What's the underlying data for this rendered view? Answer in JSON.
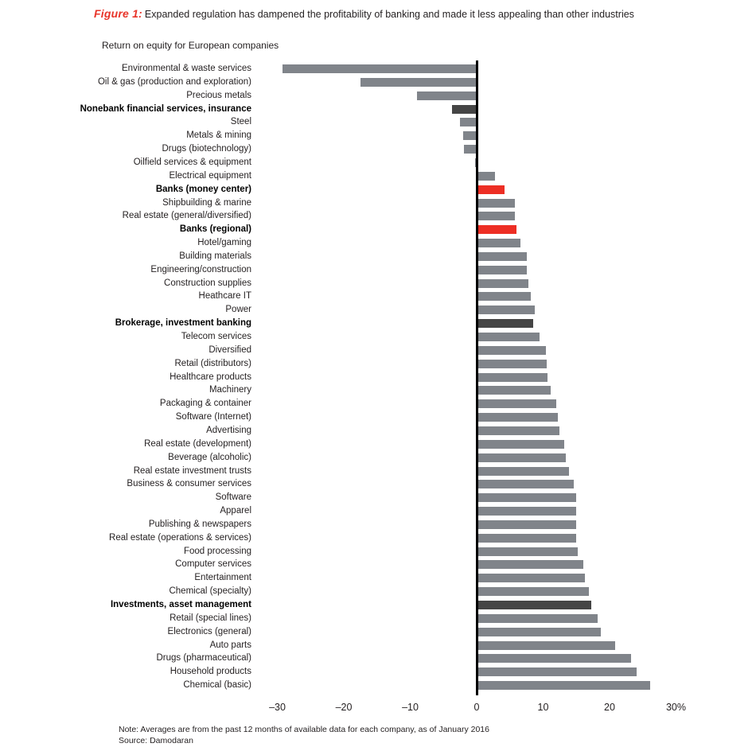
{
  "figure": {
    "label": "Figure 1:",
    "caption": "Expanded regulation has dampened the profitability of banking and made it less appealing than other industries",
    "subtitle": "Return on equity for European companies",
    "note": "Note: Averages are from the past 12 months of available data for each company, as of January 2016",
    "source": "Source: Damodaran"
  },
  "colors": {
    "gray": "#80848a",
    "dark": "#454545",
    "red": "#ed2e24",
    "accent": "#ed2e24",
    "axis": "#000000"
  },
  "chart_data": {
    "type": "bar",
    "orientation": "horizontal",
    "title": "Expanded regulation has dampened the profitability of banking and made it less appealing than other industries",
    "subtitle": "Return on equity for European companies",
    "xlabel": "",
    "ylabel": "",
    "xlim": [
      -33,
      30
    ],
    "xticks": [
      -30,
      -20,
      -10,
      0,
      10,
      20,
      30
    ],
    "xticklabels": [
      "–30",
      "–20",
      "–10",
      "0",
      "10",
      "20",
      "30%"
    ],
    "grid": false,
    "legend": false,
    "note": "Note: Averages are from the past 12 months of available data for each company, as of January 2016",
    "source": "Source: Damodaran",
    "categories": [
      "Environmental & waste services",
      "Oil & gas (production and exploration)",
      "Precious metals",
      "Nonebank financial services, insurance",
      "Steel",
      "Metals & mining",
      "Drugs (biotechnology)",
      "Oilfield services & equipment",
      "Electrical equipment",
      "Banks (money center)",
      "Shipbuilding & marine",
      "Real estate (general/diversified)",
      "Banks (regional)",
      "Hotel/gaming",
      "Building materials",
      "Engineering/construction",
      "Construction supplies",
      "Heathcare IT",
      "Power",
      "Brokerage, investment banking",
      "Telecom services",
      "Diversified",
      "Retail (distributors)",
      "Healthcare products",
      "Machinery",
      "Packaging & container",
      "Software (Internet)",
      "Advertising",
      "Real estate (development)",
      "Beverage (alcoholic)",
      "Real estate investment trusts",
      "Business & consumer services",
      "Software",
      "Apparel",
      "Publishing & newspapers",
      "Real estate (operations & services)",
      "Food processing",
      "Computer services",
      "Entertainment",
      "Chemical (specialty)",
      "Investments, asset management",
      "Retail (special lines)",
      "Electronics (general)",
      "Auto parts",
      "Drugs (pharmaceutical)",
      "Household products",
      "Chemical (basic)"
    ],
    "values": [
      -29.2,
      -17.5,
      -9.0,
      -3.7,
      -2.5,
      -2.0,
      -1.9,
      -0.2,
      2.8,
      4.2,
      5.7,
      5.7,
      6.0,
      6.6,
      7.5,
      7.6,
      7.8,
      8.1,
      8.8,
      8.5,
      9.5,
      10.4,
      10.5,
      10.6,
      11.1,
      12.0,
      12.2,
      12.4,
      13.2,
      13.4,
      13.9,
      14.6,
      15.0,
      15.0,
      15.0,
      15.0,
      15.2,
      16.0,
      16.3,
      16.9,
      17.2,
      18.2,
      18.7,
      20.8,
      23.2,
      24.1,
      26.1
    ],
    "bar_styles": [
      "gray",
      "gray",
      "gray",
      "dark",
      "gray",
      "gray",
      "gray",
      "gray",
      "gray",
      "red",
      "gray",
      "gray",
      "red",
      "gray",
      "gray",
      "gray",
      "gray",
      "gray",
      "gray",
      "dark",
      "gray",
      "gray",
      "gray",
      "gray",
      "gray",
      "gray",
      "gray",
      "gray",
      "gray",
      "gray",
      "gray",
      "gray",
      "gray",
      "gray",
      "gray",
      "gray",
      "gray",
      "gray",
      "gray",
      "gray",
      "dark",
      "gray",
      "gray",
      "gray",
      "gray",
      "gray",
      "gray"
    ],
    "highlighted_categories": [
      "Nonebank financial services, insurance",
      "Banks (money center)",
      "Banks (regional)",
      "Brokerage, investment banking",
      "Investments, asset management"
    ]
  }
}
